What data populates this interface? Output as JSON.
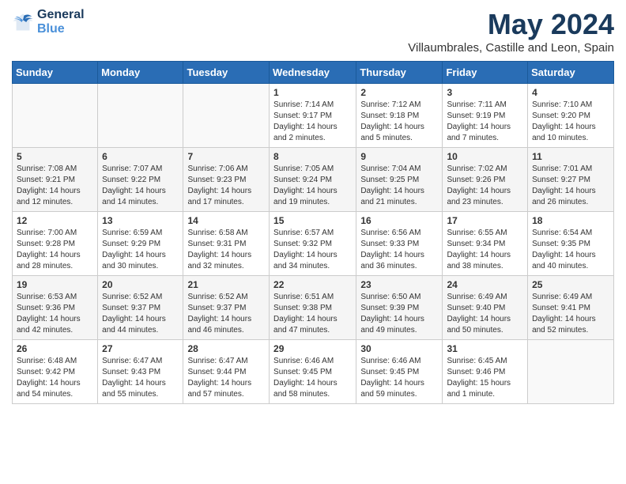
{
  "header": {
    "logo_line1": "General",
    "logo_line2": "Blue",
    "month": "May 2024",
    "location": "Villaumbrales, Castille and Leon, Spain"
  },
  "weekdays": [
    "Sunday",
    "Monday",
    "Tuesday",
    "Wednesday",
    "Thursday",
    "Friday",
    "Saturday"
  ],
  "weeks": [
    [
      {
        "num": "",
        "info": ""
      },
      {
        "num": "",
        "info": ""
      },
      {
        "num": "",
        "info": ""
      },
      {
        "num": "1",
        "info": "Sunrise: 7:14 AM\nSunset: 9:17 PM\nDaylight: 14 hours\nand 2 minutes."
      },
      {
        "num": "2",
        "info": "Sunrise: 7:12 AM\nSunset: 9:18 PM\nDaylight: 14 hours\nand 5 minutes."
      },
      {
        "num": "3",
        "info": "Sunrise: 7:11 AM\nSunset: 9:19 PM\nDaylight: 14 hours\nand 7 minutes."
      },
      {
        "num": "4",
        "info": "Sunrise: 7:10 AM\nSunset: 9:20 PM\nDaylight: 14 hours\nand 10 minutes."
      }
    ],
    [
      {
        "num": "5",
        "info": "Sunrise: 7:08 AM\nSunset: 9:21 PM\nDaylight: 14 hours\nand 12 minutes."
      },
      {
        "num": "6",
        "info": "Sunrise: 7:07 AM\nSunset: 9:22 PM\nDaylight: 14 hours\nand 14 minutes."
      },
      {
        "num": "7",
        "info": "Sunrise: 7:06 AM\nSunset: 9:23 PM\nDaylight: 14 hours\nand 17 minutes."
      },
      {
        "num": "8",
        "info": "Sunrise: 7:05 AM\nSunset: 9:24 PM\nDaylight: 14 hours\nand 19 minutes."
      },
      {
        "num": "9",
        "info": "Sunrise: 7:04 AM\nSunset: 9:25 PM\nDaylight: 14 hours\nand 21 minutes."
      },
      {
        "num": "10",
        "info": "Sunrise: 7:02 AM\nSunset: 9:26 PM\nDaylight: 14 hours\nand 23 minutes."
      },
      {
        "num": "11",
        "info": "Sunrise: 7:01 AM\nSunset: 9:27 PM\nDaylight: 14 hours\nand 26 minutes."
      }
    ],
    [
      {
        "num": "12",
        "info": "Sunrise: 7:00 AM\nSunset: 9:28 PM\nDaylight: 14 hours\nand 28 minutes."
      },
      {
        "num": "13",
        "info": "Sunrise: 6:59 AM\nSunset: 9:29 PM\nDaylight: 14 hours\nand 30 minutes."
      },
      {
        "num": "14",
        "info": "Sunrise: 6:58 AM\nSunset: 9:31 PM\nDaylight: 14 hours\nand 32 minutes."
      },
      {
        "num": "15",
        "info": "Sunrise: 6:57 AM\nSunset: 9:32 PM\nDaylight: 14 hours\nand 34 minutes."
      },
      {
        "num": "16",
        "info": "Sunrise: 6:56 AM\nSunset: 9:33 PM\nDaylight: 14 hours\nand 36 minutes."
      },
      {
        "num": "17",
        "info": "Sunrise: 6:55 AM\nSunset: 9:34 PM\nDaylight: 14 hours\nand 38 minutes."
      },
      {
        "num": "18",
        "info": "Sunrise: 6:54 AM\nSunset: 9:35 PM\nDaylight: 14 hours\nand 40 minutes."
      }
    ],
    [
      {
        "num": "19",
        "info": "Sunrise: 6:53 AM\nSunset: 9:36 PM\nDaylight: 14 hours\nand 42 minutes."
      },
      {
        "num": "20",
        "info": "Sunrise: 6:52 AM\nSunset: 9:37 PM\nDaylight: 14 hours\nand 44 minutes."
      },
      {
        "num": "21",
        "info": "Sunrise: 6:52 AM\nSunset: 9:37 PM\nDaylight: 14 hours\nand 46 minutes."
      },
      {
        "num": "22",
        "info": "Sunrise: 6:51 AM\nSunset: 9:38 PM\nDaylight: 14 hours\nand 47 minutes."
      },
      {
        "num": "23",
        "info": "Sunrise: 6:50 AM\nSunset: 9:39 PM\nDaylight: 14 hours\nand 49 minutes."
      },
      {
        "num": "24",
        "info": "Sunrise: 6:49 AM\nSunset: 9:40 PM\nDaylight: 14 hours\nand 50 minutes."
      },
      {
        "num": "25",
        "info": "Sunrise: 6:49 AM\nSunset: 9:41 PM\nDaylight: 14 hours\nand 52 minutes."
      }
    ],
    [
      {
        "num": "26",
        "info": "Sunrise: 6:48 AM\nSunset: 9:42 PM\nDaylight: 14 hours\nand 54 minutes."
      },
      {
        "num": "27",
        "info": "Sunrise: 6:47 AM\nSunset: 9:43 PM\nDaylight: 14 hours\nand 55 minutes."
      },
      {
        "num": "28",
        "info": "Sunrise: 6:47 AM\nSunset: 9:44 PM\nDaylight: 14 hours\nand 57 minutes."
      },
      {
        "num": "29",
        "info": "Sunrise: 6:46 AM\nSunset: 9:45 PM\nDaylight: 14 hours\nand 58 minutes."
      },
      {
        "num": "30",
        "info": "Sunrise: 6:46 AM\nSunset: 9:45 PM\nDaylight: 14 hours\nand 59 minutes."
      },
      {
        "num": "31",
        "info": "Sunrise: 6:45 AM\nSunset: 9:46 PM\nDaylight: 15 hours\nand 1 minute."
      },
      {
        "num": "",
        "info": ""
      }
    ]
  ]
}
